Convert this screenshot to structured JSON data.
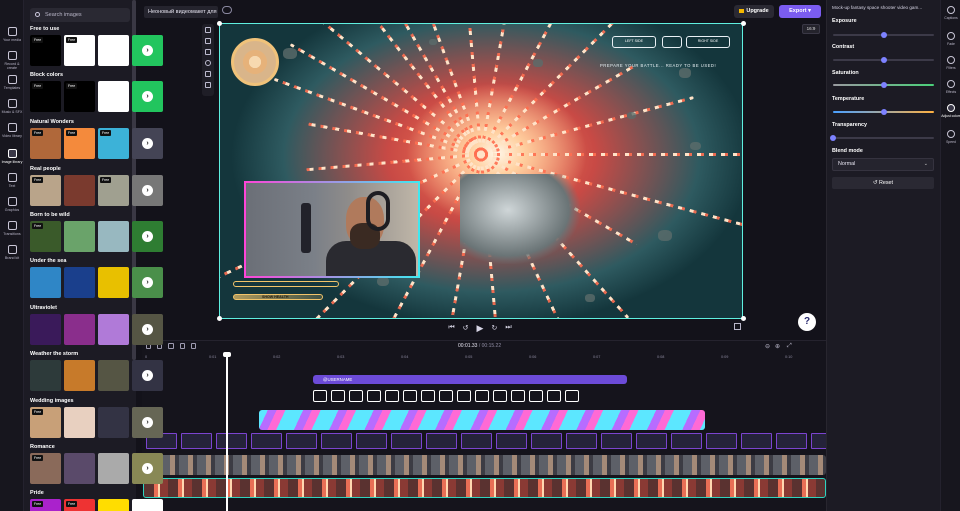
{
  "project": {
    "name": "Неоновый видеомакет для",
    "upgrade_label": "Upgrade",
    "export_label": "Export"
  },
  "left_rail": [
    {
      "label": "Your media",
      "icon": "folder-icon"
    },
    {
      "label": "Record & create",
      "icon": "camera-icon"
    },
    {
      "label": "Templates",
      "icon": "templates-icon"
    },
    {
      "label": "Music & SFX",
      "icon": "music-icon"
    },
    {
      "label": "Video library",
      "icon": "video-icon"
    },
    {
      "label": "Image library",
      "icon": "image-icon",
      "active": true
    },
    {
      "label": "Text",
      "icon": "text-icon"
    },
    {
      "label": "Graphics",
      "icon": "shapes-icon"
    },
    {
      "label": "Transitions",
      "icon": "transitions-icon"
    },
    {
      "label": "Brand kit",
      "icon": "brand-icon"
    }
  ],
  "library": {
    "search_placeholder": "Search images",
    "categories": [
      {
        "title": "Free to use",
        "tags": [
          "Free",
          "Free",
          "",
          ""
        ]
      },
      {
        "title": "Block colors",
        "tags": [
          "Free",
          "Free",
          "",
          ""
        ]
      },
      {
        "title": "Natural Wonders",
        "tags": [
          "Free",
          "Free",
          "Free",
          ""
        ]
      },
      {
        "title": "Real people",
        "tags": [
          "Free",
          "",
          "Free",
          ""
        ]
      },
      {
        "title": "Born to be wild",
        "tags": [
          "Free",
          "",
          "",
          ""
        ]
      },
      {
        "title": "Under the sea",
        "tags": [
          "",
          "",
          "",
          ""
        ]
      },
      {
        "title": "Ultraviolet",
        "tags": [
          "",
          "",
          "",
          ""
        ]
      },
      {
        "title": "Weather the storm",
        "tags": [
          "",
          "",
          "",
          ""
        ]
      },
      {
        "title": "Wedding images",
        "tags": [
          "Free",
          "",
          "",
          ""
        ]
      },
      {
        "title": "Romance",
        "tags": [
          "Free",
          "",
          "",
          ""
        ]
      },
      {
        "title": "Pride",
        "tags": [
          "Free",
          "Free",
          "",
          ""
        ]
      }
    ]
  },
  "canvas": {
    "aspect_ratio": "16:9",
    "hud_text": "PREPARE YOUR BATTLE... READY TO BE USED!",
    "hud_top_left": "LEFT SIDE",
    "hud_top_right": "RIGHT SIDE",
    "bar_label": "SHOW HEALTH"
  },
  "playback": {
    "current": "00:01.33",
    "total": "/ 00:15.22"
  },
  "timeline": {
    "ticks": [
      "0",
      "0:01",
      "0:02",
      "0:03",
      "0:04",
      "0:05",
      "0:06",
      "0:07",
      "0:08",
      "0:09",
      "0:10"
    ],
    "text_clip": "@USERNAME"
  },
  "properties": {
    "title": "Mock-up fantasy space shooter video gam...",
    "exposure_label": "Exposure",
    "contrast_label": "Contrast",
    "saturation_label": "Saturation",
    "temperature_label": "Temperature",
    "transparency_label": "Transparency",
    "blend_label": "Blend mode",
    "blend_value": "Normal",
    "reset_label": "Reset",
    "values": {
      "exposure": 0.5,
      "contrast": 0.5,
      "saturation": 0.5,
      "temperature": 0.5,
      "transparency": 0.0
    }
  },
  "right_rail": [
    {
      "label": "Captions",
      "icon": "captions-icon"
    },
    {
      "label": "Fade",
      "icon": "fade-icon"
    },
    {
      "label": "Filters",
      "icon": "filters-icon"
    },
    {
      "label": "Effects",
      "icon": "effects-icon"
    },
    {
      "label": "Adjust colors",
      "icon": "adjust-colors-icon",
      "active": true
    },
    {
      "label": "Speed",
      "icon": "speed-icon"
    }
  ],
  "colors": {
    "accent": "#7b5cf0",
    "bg": "#13121a",
    "panel": "#1c1b24",
    "slider": "#7d82ff",
    "clip_text": "#6c4bd8",
    "clip_outline": "#2fd3bf"
  }
}
